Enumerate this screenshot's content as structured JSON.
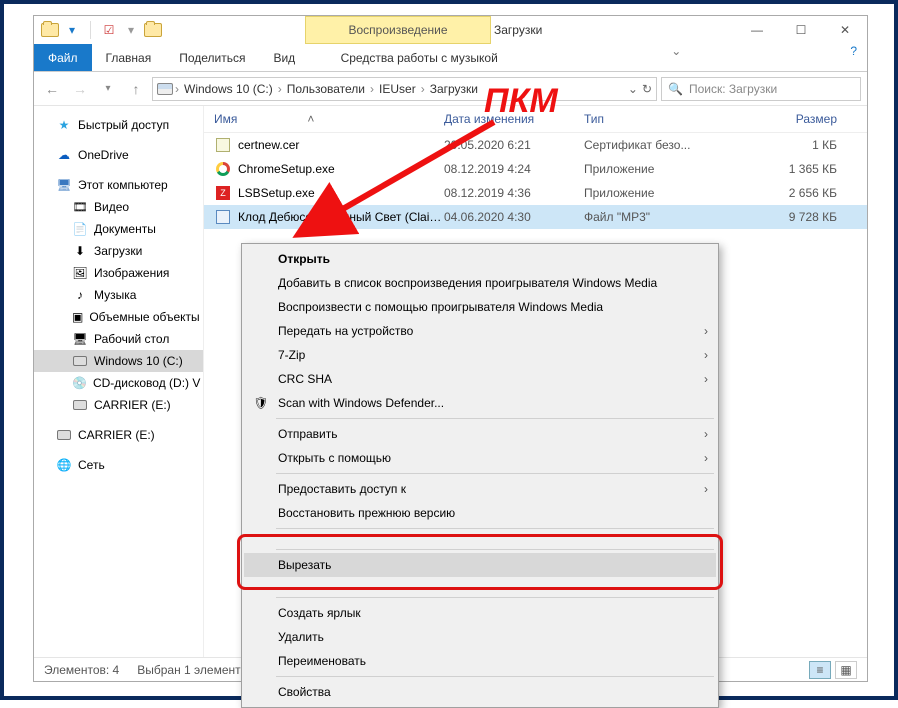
{
  "titlebar": {
    "context_group": "Воспроизведение",
    "window_title": "Загрузки"
  },
  "ribbon": {
    "file": "Файл",
    "home": "Главная",
    "share": "Поделиться",
    "view": "Вид",
    "music_tools": "Средства работы с музыкой"
  },
  "address": {
    "crumbs": [
      "Windows 10 (C:)",
      "Пользователи",
      "IEUser",
      "Загрузки"
    ],
    "search_placeholder": "Поиск: Загрузки"
  },
  "nav": {
    "quick": "Быстрый доступ",
    "onedrive": "OneDrive",
    "thispc": "Этот компьютер",
    "children": [
      "Видео",
      "Документы",
      "Загрузки",
      "Изображения",
      "Музыка",
      "Объемные объекты",
      "Рабочий стол",
      "Windows 10 (C:)",
      "CD-дисковод (D:) V",
      "CARRIER (E:)"
    ],
    "carrier2": "CARRIER (E:)",
    "network": "Сеть"
  },
  "columns": {
    "name": "Имя",
    "date": "Дата изменения",
    "type": "Тип",
    "size": "Размер"
  },
  "files": [
    {
      "icon": "cert",
      "name": "certnew.cer",
      "date": "20.05.2020 6:21",
      "type": "Сертификат безо...",
      "size": "1 КБ"
    },
    {
      "icon": "chrome",
      "name": "ChromeSetup.exe",
      "date": "08.12.2019 4:24",
      "type": "Приложение",
      "size": "1 365 КБ"
    },
    {
      "icon": "lsb",
      "name": "LSBSetup.exe",
      "date": "08.12.2019 4:36",
      "type": "Приложение",
      "size": "2 656 КБ"
    },
    {
      "icon": "mp3",
      "name": "Клод Дебюсси - Лунный Свет (Clair de...",
      "date": "04.06.2020 4:30",
      "type": "Файл \"MP3\"",
      "size": "9 728 КБ"
    }
  ],
  "context_menu": {
    "open": "Открыть",
    "add_wmp": "Добавить в список воспроизведения проигрывателя Windows Media",
    "play_wmp": "Воспроизвести с помощью проигрывателя Windows Media",
    "cast": "Передать на устройство",
    "sevenzip": "7-Zip",
    "crcsha": "CRC SHA",
    "defender": "Scan with Windows Defender...",
    "sendto": "Отправить",
    "openwith": "Открыть с помощью",
    "giveaccess": "Предоставить доступ к",
    "restore": "Восстановить прежнюю версию",
    "cut": "Вырезать",
    "shortcut": "Создать ярлык",
    "delete": "Удалить",
    "rename": "Переименовать",
    "properties": "Свойства"
  },
  "status": {
    "count": "Элементов: 4",
    "selected": "Выбран 1 элемент"
  },
  "annotation": {
    "label": "ПКМ"
  }
}
